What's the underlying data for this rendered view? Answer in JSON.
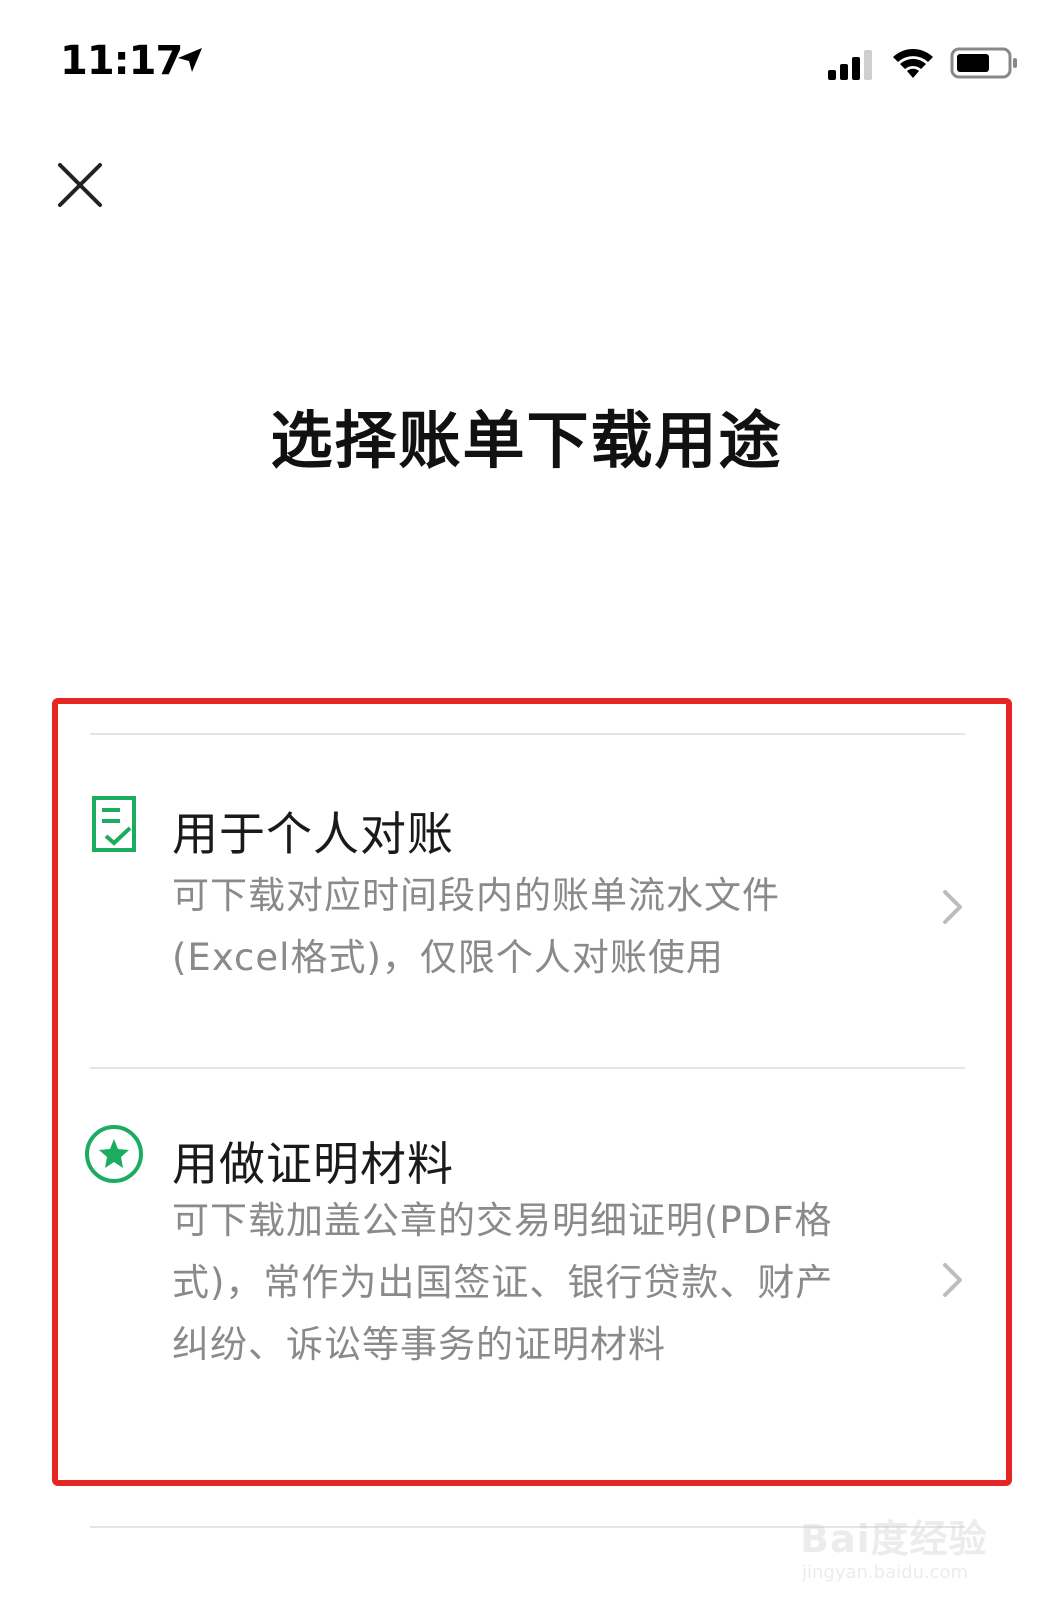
{
  "status_bar": {
    "time": "11:17",
    "icons": [
      "location-arrow-icon",
      "signal-icon",
      "wifi-icon",
      "battery-icon"
    ]
  },
  "header": {
    "close_icon": "close-icon",
    "title": "选择账单下载用途"
  },
  "options": [
    {
      "icon": "checklist-icon",
      "title": "用于个人对账",
      "description": "可下载对应时间段内的账单流水文件(Excel格式)，仅限个人对账使用"
    },
    {
      "icon": "star-badge-icon",
      "title": "用做证明材料",
      "description": "可下载加盖公章的交易明细证明(PDF格式)，常作为出国签证、银行贷款、财产纠纷、诉讼等事务的证明材料"
    }
  ],
  "colors": {
    "accent_green": "#1aad5f",
    "highlight_red": "#e52622",
    "description_gray": "#8a8a8a"
  },
  "watermark": {
    "brand": "Bai度经验",
    "url": "jingyan.baidu.com"
  }
}
